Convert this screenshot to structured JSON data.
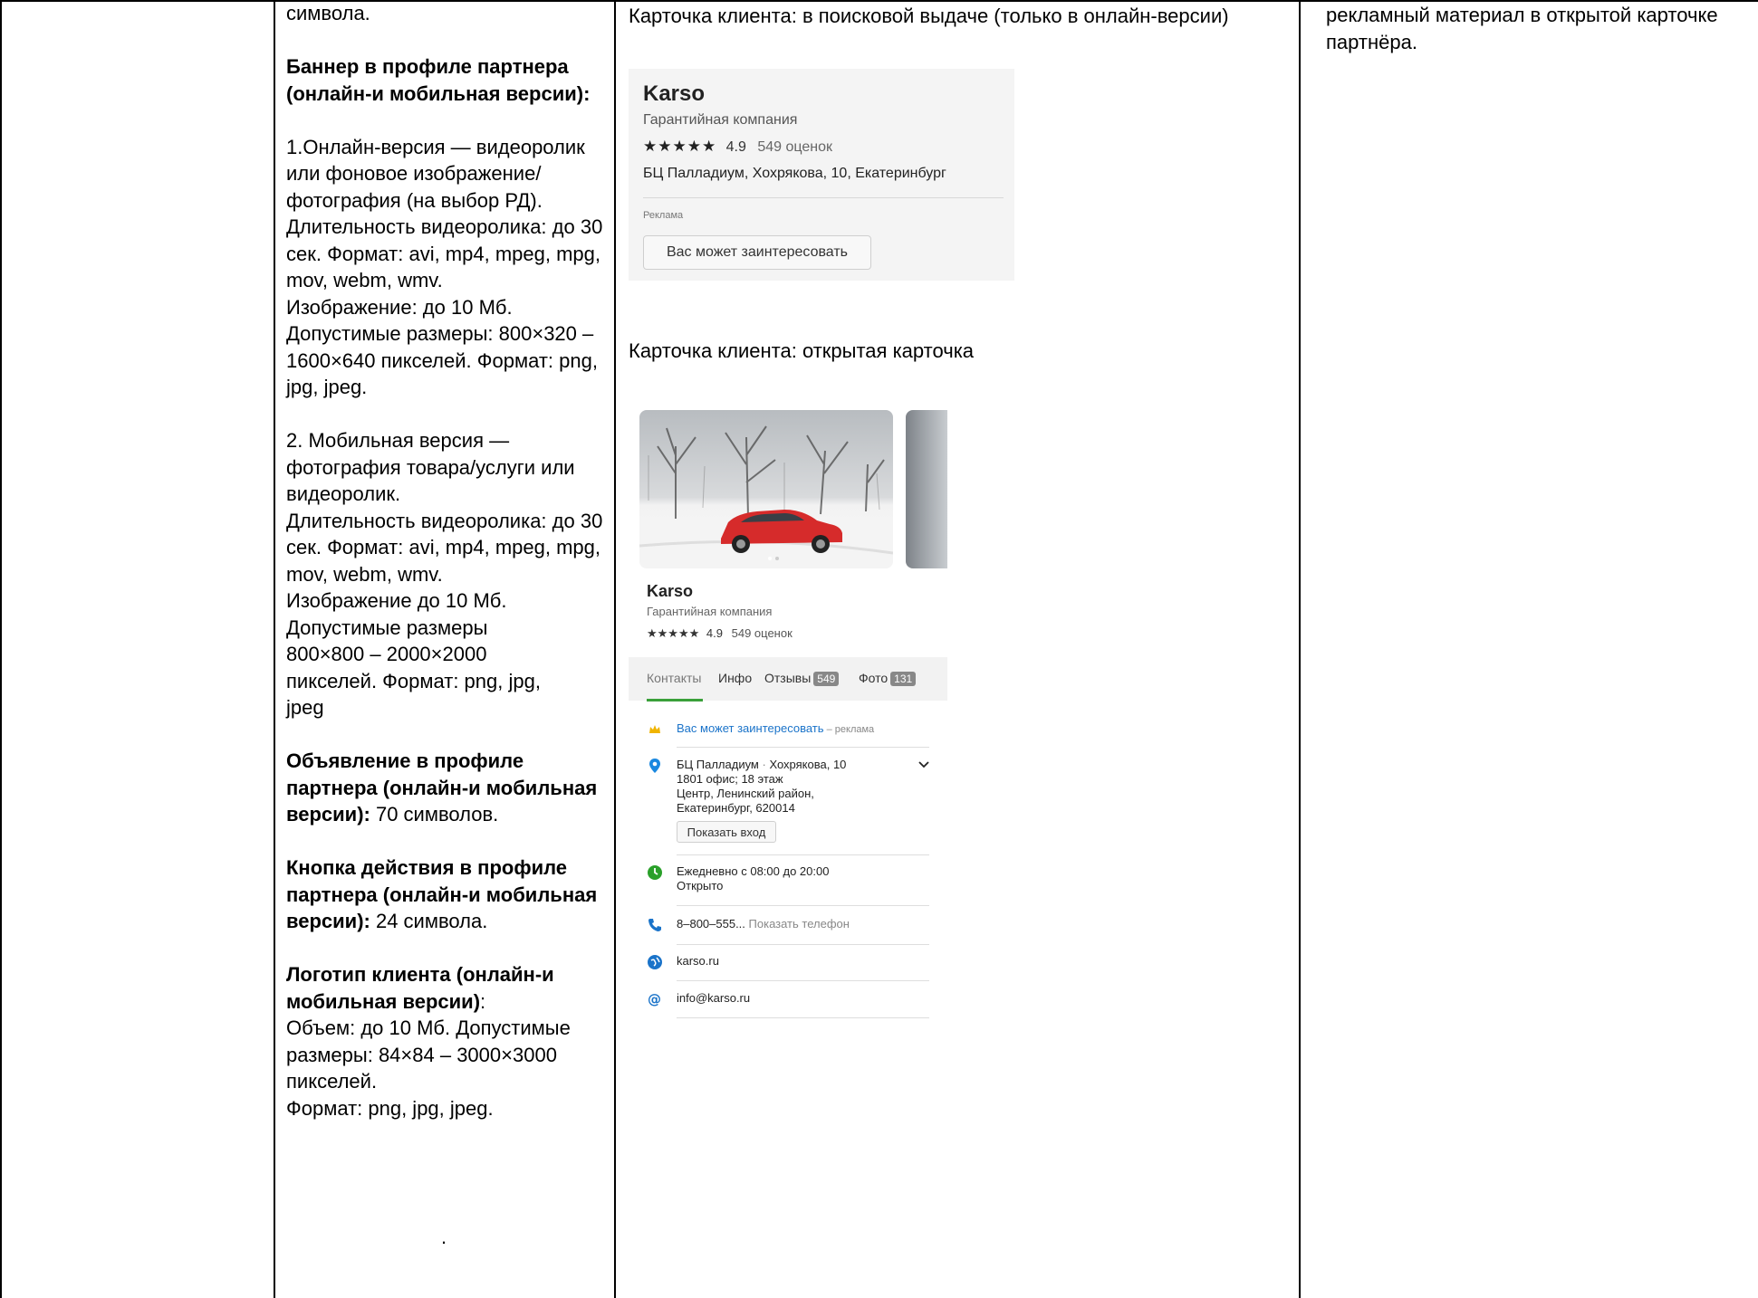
{
  "column_text": {
    "top_fragment": "символа.",
    "banner_heading": "Баннер в профиле партнера (онлайн-и мобильная версии):",
    "online_version": "1.Онлайн-версия — видеоролик или фоновое изображение/фотография (на выбор РД).",
    "online_video": "Длительность видеоролика: до 30 сек. Формат: avi, mp4, mpeg, mpg, mov, webm, wmv.",
    "online_image": "Изображение: до 10 Мб. Допустимые размеры: 800×320 – 1600×640 пикселей. Формат: png, jpg, jpeg.",
    "mobile_version": "2. Мобильная версия — фотография товара/услуги или видеоролик.",
    "mobile_video": "Длительность видеоролика: до 30 сек. Формат: avi, mp4, mpeg, mpg, mov, webm, wmv.",
    "mobile_image": "Изображение до 10 Мб. Допустимые размеры 800×800 – 2000×2000 пикселей. Формат: png, jpg, jpeg",
    "ad_heading": "Объявление в профиле партнера (онлайн-и мобильная версии):",
    "ad_value": " 70 символов.",
    "button_heading": "Кнопка действия в профиле партнера (онлайн-и мобильная версии):",
    "button_value": " 24 символа.",
    "logo_heading": "Логотип клиента (онлайн-и мобильная версии)",
    "logo_colon": ":",
    "logo_size": "Объем: до 10 Мб. Допустимые размеры: 84×84 – 3000×3000 пикселей.",
    "logo_format": "Формат: png, jpg, jpeg.",
    "trailing_dot": "."
  },
  "right_column": {
    "text": "рекламный материал в открытой карточке партнёра."
  },
  "captions": {
    "search": "Карточка клиента: в поисковой выдаче (только в онлайн-версии)",
    "open": "Карточка клиента: открытая карточка"
  },
  "search_card": {
    "name": "Karso",
    "category": "Гарантийная компания",
    "stars": "★★★★★",
    "rating": "4.9",
    "reviews": "549 оценок",
    "address": "БЦ Палладиум, Хохрякова, 10, Екатеринбург",
    "ad_label": "Реклама",
    "button": "Вас может заинтересовать"
  },
  "open_card": {
    "name": "Karso",
    "category": "Гарантийная компания",
    "stars": "★★★★★",
    "rating": "4.9",
    "reviews": "549 оценок",
    "tabs": {
      "contacts": "Контакты",
      "info": "Инфо",
      "reviews": "Отзывы",
      "reviews_count": "549",
      "photos": "Фото",
      "photos_count": "131"
    },
    "promo": "Вас может заинтересовать",
    "promo_suffix": " – реклама",
    "addr_line1_a": "БЦ Палладиум",
    "addr_sep": " · ",
    "addr_line1_b": "Хохрякова, 10",
    "addr_line2": "1801 офис; 18 этаж",
    "addr_line3": "Центр, Ленинский район,",
    "addr_line4": "Екатеринбург, 620014",
    "entry_button": "Показать вход",
    "hours": "Ежедневно с 08:00 до 20:00",
    "status": "Открыто",
    "phone": "8–800–555...",
    "phone_action": " Показать телефон",
    "website": "karso.ru",
    "email": "info@karso.ru"
  },
  "colors": {
    "accent_green": "#3aa03a",
    "link_blue": "#1a73c9",
    "car_red": "#d62b2b"
  }
}
